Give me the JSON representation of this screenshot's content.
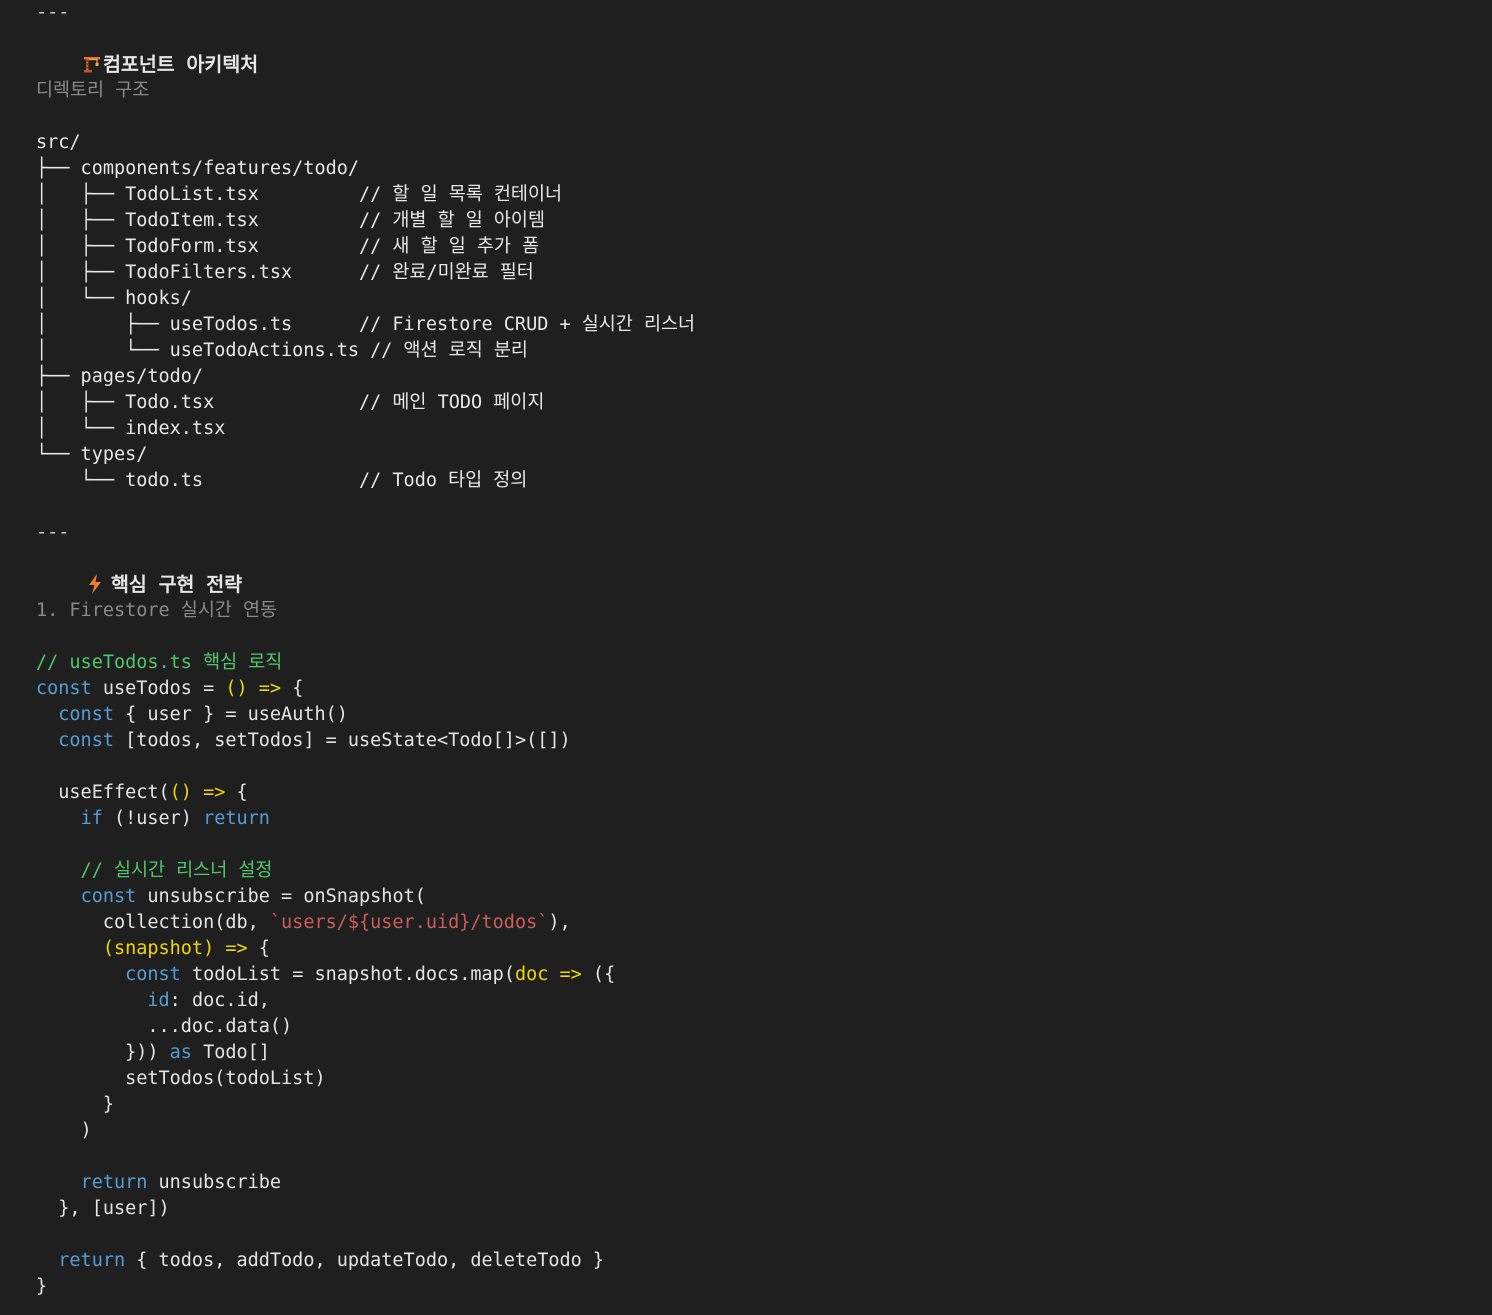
{
  "hr1": "---",
  "arch_title": "컴포넌트 아키텍처",
  "arch_icon": "construction-crane-icon",
  "dir_title": "디렉토리 구조",
  "tree": [
    "src/",
    "├── components/features/todo/",
    "│   ├── TodoList.tsx         // 할 일 목록 컨테이너",
    "│   ├── TodoItem.tsx         // 개별 할 일 아이템",
    "│   ├── TodoForm.tsx         // 새 할 일 추가 폼",
    "│   ├── TodoFilters.tsx      // 완료/미완료 필터",
    "│   └── hooks/",
    "│       ├── useTodos.ts      // Firestore CRUD + 실시간 리스너",
    "│       └── useTodoActions.ts // 액션 로직 분리",
    "├── pages/todo/",
    "│   ├── Todo.tsx             // 메인 TODO 페이지",
    "│   └── index.tsx",
    "└── types/",
    "    └── todo.ts              // Todo 타입 정의"
  ],
  "hr2": "---",
  "strategy_title": "핵심 구현 전략",
  "strategy_icon": "lightning-bolt-icon",
  "section1_title": "1. Firestore 실시간 연동",
  "code": {
    "c1": "// useTodos.ts 핵심 로직",
    "l2a": "const",
    "l2b": " useTodos = ",
    "l2c": "()",
    "l2d": " ",
    "l2e": "=>",
    "l2f": " {",
    "l3a": "  ",
    "l3b": "const",
    "l3c": " { user } = useAuth()",
    "l4a": "  ",
    "l4b": "const",
    "l4c": " [todos, setTodos] = useState<Todo[]>([])",
    "l6a": "  useEffect(",
    "l6b": "()",
    "l6c": " ",
    "l6d": "=>",
    "l6e": " {",
    "l7a": "    ",
    "l7b": "if",
    "l7c": " (!user) ",
    "l7d": "return",
    "c2": "    // 실시간 리스너 설정",
    "l10a": "    ",
    "l10b": "const",
    "l10c": " unsubscribe = onSnapshot(",
    "l11a": "      collection(db, ",
    "l11b": "`users/${user.uid}/todos`",
    "l11c": "),",
    "l12a": "      ",
    "l12b": "(snapshot)",
    "l12c": " ",
    "l12d": "=>",
    "l12e": " {",
    "l13a": "        ",
    "l13b": "const",
    "l13c": " todoList = snapshot.docs.map(",
    "l13d": "doc",
    "l13e": " ",
    "l13f": "=>",
    "l13g": " ({",
    "l14a": "          ",
    "l14b": "id",
    "l14c": ": doc.id,",
    "l15": "          ...doc.data()",
    "l16a": "        })) ",
    "l16b": "as",
    "l16c": " Todo[]",
    "l17": "        setTodos(todoList)",
    "l18": "      }",
    "l19": "    )",
    "l21a": "    ",
    "l21b": "return",
    "l21c": " unsubscribe",
    "l22": "  }, [user])",
    "l24a": "  ",
    "l24b": "return",
    "l24c": " { todos, addTodo, updateTodo, deleteTodo }",
    "l25": "}"
  }
}
